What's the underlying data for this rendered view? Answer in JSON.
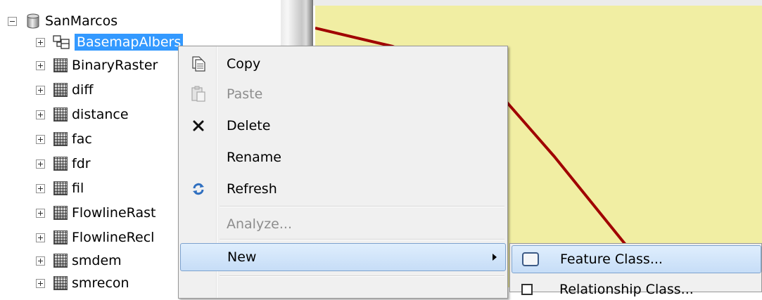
{
  "tree": {
    "root": {
      "label": "SanMarcos"
    },
    "selected": {
      "label": "BasemapAlbers"
    },
    "rasters": [
      {
        "label": "BinaryRaster"
      },
      {
        "label": "diff"
      },
      {
        "label": "distance"
      },
      {
        "label": "fac"
      },
      {
        "label": "fdr"
      },
      {
        "label": "fil"
      },
      {
        "label": "FlowlineRast"
      },
      {
        "label": "FlowlineRecl"
      },
      {
        "label": "smdem"
      },
      {
        "label": "smrecon"
      }
    ]
  },
  "context_menu": {
    "items": [
      {
        "label": "Copy",
        "icon": "copy-icon",
        "enabled": true
      },
      {
        "label": "Paste",
        "icon": "paste-icon",
        "enabled": false
      },
      {
        "label": "Delete",
        "icon": "delete-icon",
        "enabled": true
      },
      {
        "label": "Rename",
        "icon": "",
        "enabled": true
      },
      {
        "label": "Refresh",
        "icon": "refresh-icon",
        "enabled": true
      },
      {
        "label": "Analyze...",
        "icon": "",
        "enabled": false
      },
      {
        "label": "New",
        "icon": "",
        "enabled": true,
        "has_submenu": true,
        "highlighted": true
      }
    ]
  },
  "submenu": {
    "items": [
      {
        "label": "Feature Class...",
        "icon": "feature-class-icon",
        "highlighted": true
      },
      {
        "label": "Relationship Class...",
        "icon": "relationship-class-icon",
        "highlighted": false
      }
    ]
  },
  "colors": {
    "selection": "#3399ff",
    "map_background": "#f1eea3",
    "map_line": "#a00000",
    "menu_background": "#f0f0f0",
    "highlight_border": "#7da2ce"
  }
}
